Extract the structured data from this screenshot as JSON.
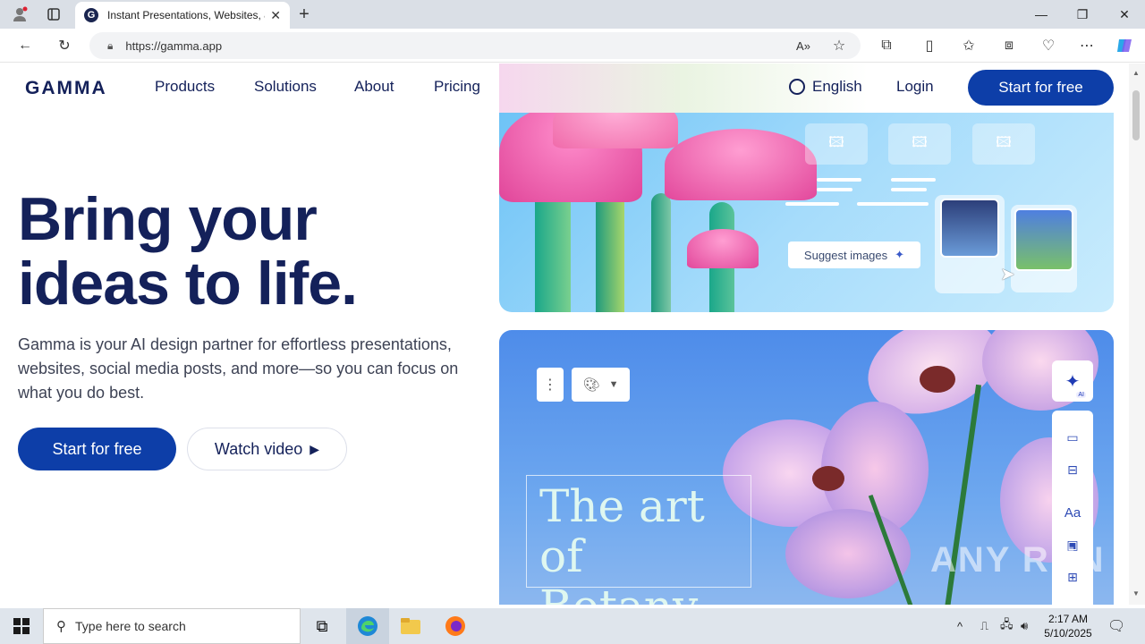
{
  "browser": {
    "tab_title": "Instant Presentations, Websites, &",
    "tab_favicon": "G",
    "url": "https://gamma.app",
    "new_tab": "+",
    "window_controls": {
      "minimize": "—",
      "maximize": "❐",
      "close": "✕"
    }
  },
  "site": {
    "logo": "GAMMA",
    "nav": [
      "Products",
      "Solutions",
      "About",
      "Pricing"
    ],
    "language": "English",
    "login": "Login",
    "cta_top": "Start for free",
    "hero_line1": "Bring your",
    "hero_line2": "ideas to life.",
    "subtitle": "Gamma is your AI design partner for effortless presentations, websites, social media posts, and more—so you can focus on what you do best.",
    "cta_start": "Start for free",
    "cta_watch": "Watch video",
    "suggest_images": "Suggest images",
    "botany_line1": "The art",
    "botany_line2": "of Botany",
    "ai_badge": "AI",
    "tool_text": "Aa"
  },
  "watermark": "ANY RUN",
  "taskbar": {
    "search_placeholder": "Type here to search",
    "time": "2:17 AM",
    "date": "5/10/2025"
  },
  "colors": {
    "brand_navy": "#14215a",
    "brand_blue": "#0d3ea8"
  }
}
